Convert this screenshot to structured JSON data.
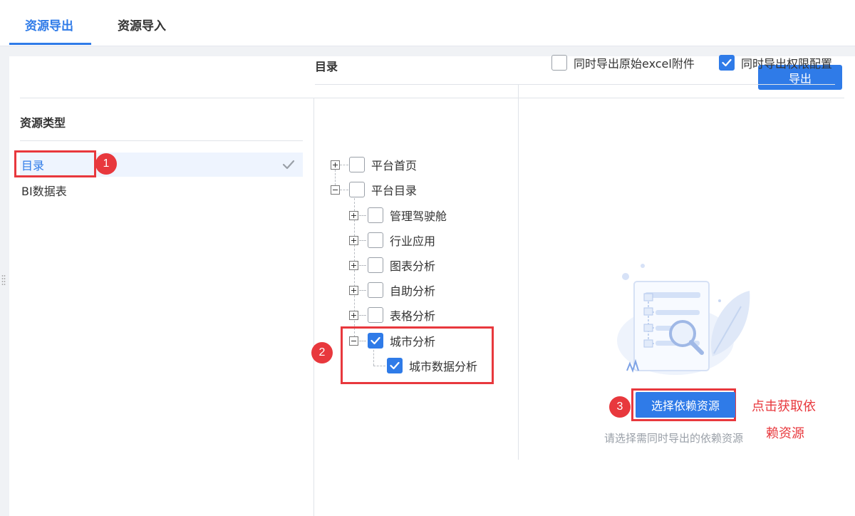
{
  "tabs": [
    {
      "label": "资源导出",
      "active": true
    },
    {
      "label": "资源导入",
      "active": false
    }
  ],
  "toolbar": {
    "export_label": "导出"
  },
  "resource_types": {
    "title": "资源类型",
    "items": [
      {
        "label": "目录",
        "selected": true
      },
      {
        "label": "BI数据表",
        "selected": false
      }
    ]
  },
  "catalog": {
    "title": "目录",
    "options": [
      {
        "label": "同时导出原始excel附件",
        "checked": false
      },
      {
        "label": "同时导出权限配置",
        "checked": true
      }
    ],
    "tree": [
      {
        "label": "平台首页",
        "expander": "plus",
        "checked": false
      },
      {
        "label": "平台目录",
        "expander": "minus",
        "checked": false
      },
      {
        "label": "管理驾驶舱",
        "expander": "plus",
        "checked": false
      },
      {
        "label": "行业应用",
        "expander": "plus",
        "checked": false
      },
      {
        "label": "图表分析",
        "expander": "plus",
        "checked": false
      },
      {
        "label": "自助分析",
        "expander": "plus",
        "checked": false
      },
      {
        "label": "表格分析",
        "expander": "plus",
        "checked": false
      },
      {
        "label": "城市分析",
        "expander": "minus",
        "checked": true
      },
      {
        "label": "城市数据分析",
        "expander": "none",
        "checked": true
      }
    ]
  },
  "dependency": {
    "button_label": "选择依赖资源",
    "hint": "请选择需同时导出的依赖资源"
  },
  "annotations": {
    "badges": [
      "1",
      "2",
      "3"
    ],
    "note_line1": "点击获取依",
    "note_line2": "赖资源",
    "color": "#e8383d"
  },
  "colors": {
    "accent": "#2f7be8",
    "annotation": "#e8383d"
  }
}
